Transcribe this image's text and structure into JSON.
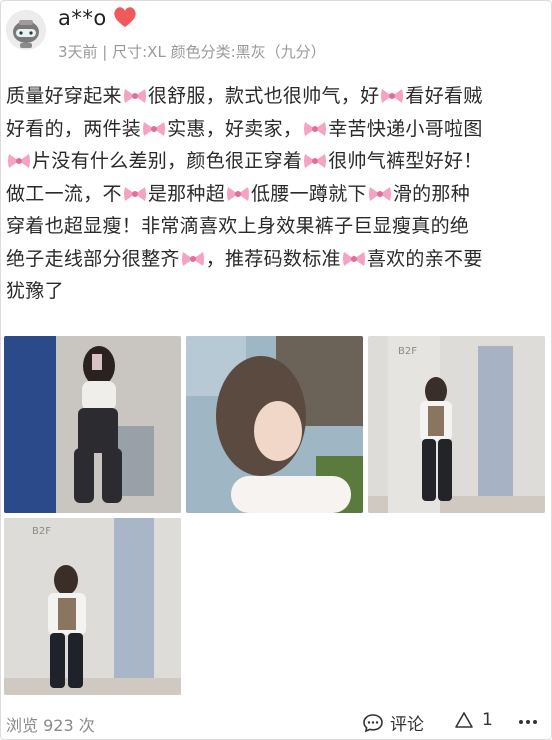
{
  "review": {
    "user": {
      "name": "a**o",
      "avatar_icon": "robot-avatar-icon",
      "badge_icon": "heart-icon",
      "badge_color": "#f05a5a"
    },
    "meta": "3天前 | 尺寸:XL 颜色分类:黑灰（九分）",
    "lines": [
      [
        "质量好穿起来",
        "很舒服，款式也很帅气，好",
        "看好看贼"
      ],
      [
        "好看的，两件装",
        "实惠，好卖家，",
        "幸苦快递小哥啦图"
      ],
      [
        "",
        "片没有什么差别，颜色很正穿着",
        "很帅气裤型好好！"
      ],
      [
        "做工一流，不",
        "是那种超",
        "低腰一蹲就下",
        "滑的那种"
      ],
      [
        "穿着也超显瘦！非常滴喜欢上身效果裤子巨显瘦真的绝"
      ],
      [
        "绝子走线部分很整齐",
        "，推荐码数标准",
        "喜欢的亲不要"
      ],
      [
        "犹豫了"
      ]
    ],
    "inline_icon": "bow-emoji-icon",
    "photos": [
      "photo-1",
      "photo-2",
      "photo-3",
      "photo-4"
    ]
  },
  "footer": {
    "views": "浏览 923 次",
    "comment_label": "评论",
    "like_count": "1"
  }
}
